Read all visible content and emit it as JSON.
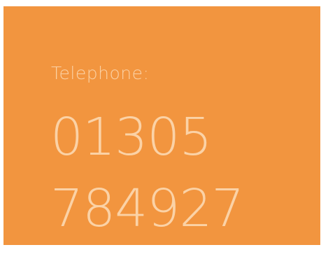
{
  "contact": {
    "label": "Telephone:",
    "phone_line_1": "01305",
    "phone_line_2": "784927"
  },
  "colors": {
    "card_background": "#f2953f",
    "text": "#fbd2a6"
  }
}
